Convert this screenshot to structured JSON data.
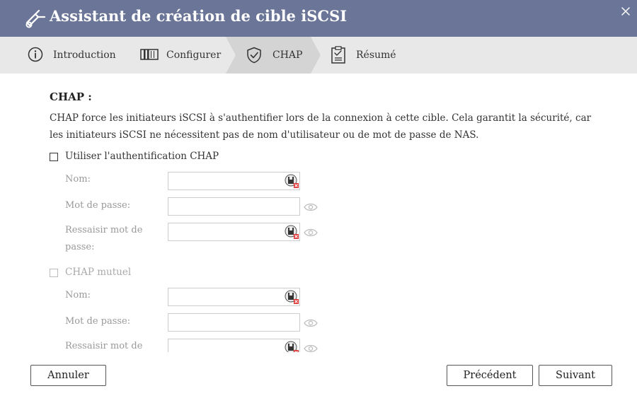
{
  "window": {
    "title": "Assistant de création de cible iSCSI",
    "icons": {
      "app": "iscsi-target-icon",
      "close": "close-icon"
    }
  },
  "steps": [
    {
      "label": "Introduction",
      "icon": "info-icon",
      "active": false
    },
    {
      "label": "Configurer",
      "icon": "settings-panel-icon",
      "active": false
    },
    {
      "label": "CHAP",
      "icon": "shield-check-icon",
      "active": true
    },
    {
      "label": "Résumé",
      "icon": "clipboard-check-icon",
      "active": false
    }
  ],
  "content": {
    "heading": "CHAP :",
    "description": "CHAP force les initiateurs iSCSI à s'authentifier lors de la connexion à cette cible. Cela garantit la sécurité, car les initiateurs iSCSI ne nécessitent pas de nom d'utilisateur ou de mot de passe de NAS.",
    "chap": {
      "checkbox_label": "Utiliser l'authentification CHAP",
      "checked": false,
      "fields": {
        "name_label": "Nom:",
        "password_label": "Mot de passe:",
        "confirm_label": "Ressaisir mot de passe:"
      }
    },
    "mutual_chap": {
      "checkbox_label": "CHAP mutuel",
      "checked": false,
      "fields": {
        "name_label": "Nom:",
        "password_label": "Mot de passe:",
        "confirm_label": "Ressaisir mot de passe:"
      }
    }
  },
  "footer": {
    "cancel": "Annuler",
    "previous": "Précédent",
    "next": "Suivant"
  },
  "colors": {
    "titlebar": "#6b7597",
    "steps_bg": "#e8e8e8",
    "step_active": "#d4d4d4"
  }
}
